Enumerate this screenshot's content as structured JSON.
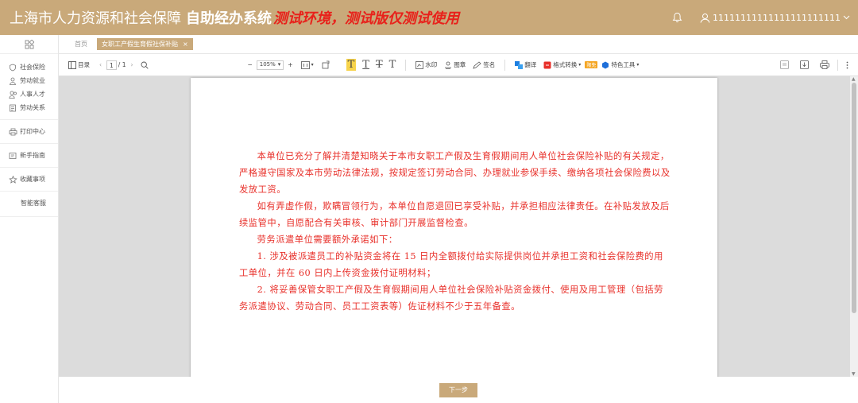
{
  "header": {
    "title": "上海市人力资源和社会保障",
    "system": "自助经办系统",
    "warning": "测试环境，测试版仅测试使用",
    "username": "11111111111111111111111"
  },
  "sidebar": {
    "items": [
      {
        "label": "社会保险",
        "icon": "shield-icon"
      },
      {
        "label": "劳动就业",
        "icon": "person-icon"
      },
      {
        "label": "人事人才",
        "icon": "people-icon"
      },
      {
        "label": "劳动关系",
        "icon": "contract-icon"
      },
      {
        "label": "打印中心",
        "icon": "printer-icon"
      },
      {
        "label": "新手指南",
        "icon": "guide-icon"
      },
      {
        "label": "收藏事项",
        "icon": "star-icon"
      },
      {
        "label": "智能客服",
        "icon": ""
      }
    ]
  },
  "tabs": {
    "home": "首页",
    "active": "女职工产假生育假社保补贴",
    "close": "×"
  },
  "toolbar": {
    "toc": "目录",
    "page_current": "1",
    "page_total": "/ 1",
    "zoom": "105%",
    "zoom_minus": "−",
    "zoom_plus": "+",
    "watermark": "水印",
    "stamp": "图章",
    "sign": "签名",
    "translate": "翻译",
    "convert": "格式转换",
    "vip": "限免",
    "special": "特色工具",
    "prev": "‹",
    "next": "›"
  },
  "document": {
    "paragraphs": [
      "本单位已充分了解并清楚知晓关于本市女职工产假及生育假期间用人单位社会保险补贴的有关规定，严格遵守国家及本市劳动法律法规，按规定签订劳动合同、办理就业参保手续、缴纳各项社会保险费以及发放工资。",
      "如有弄虚作假，欺瞒冒领行为，本单位自愿退回已享受补贴，并承担相应法律责任。在补贴发放及后续监管中，自愿配合有关审核、审计部门开展监督检查。",
      "劳务派遣单位需要额外承诺如下：",
      "1. 涉及被派遣员工的补贴资金将在 15 日内全额拨付给实际提供岗位并承担工资和社会保险费的用工单位，并在 60 日内上传资金拨付证明材料；",
      "2. 将妥善保管女职工产假及生育假期间用人单位社会保险补贴资金拨付、使用及用工管理（包括劳务派遣协议、劳动合同、员工工资表等）佐证材料不少于五年备查。"
    ]
  },
  "footer": {
    "next_button": "下一步"
  }
}
